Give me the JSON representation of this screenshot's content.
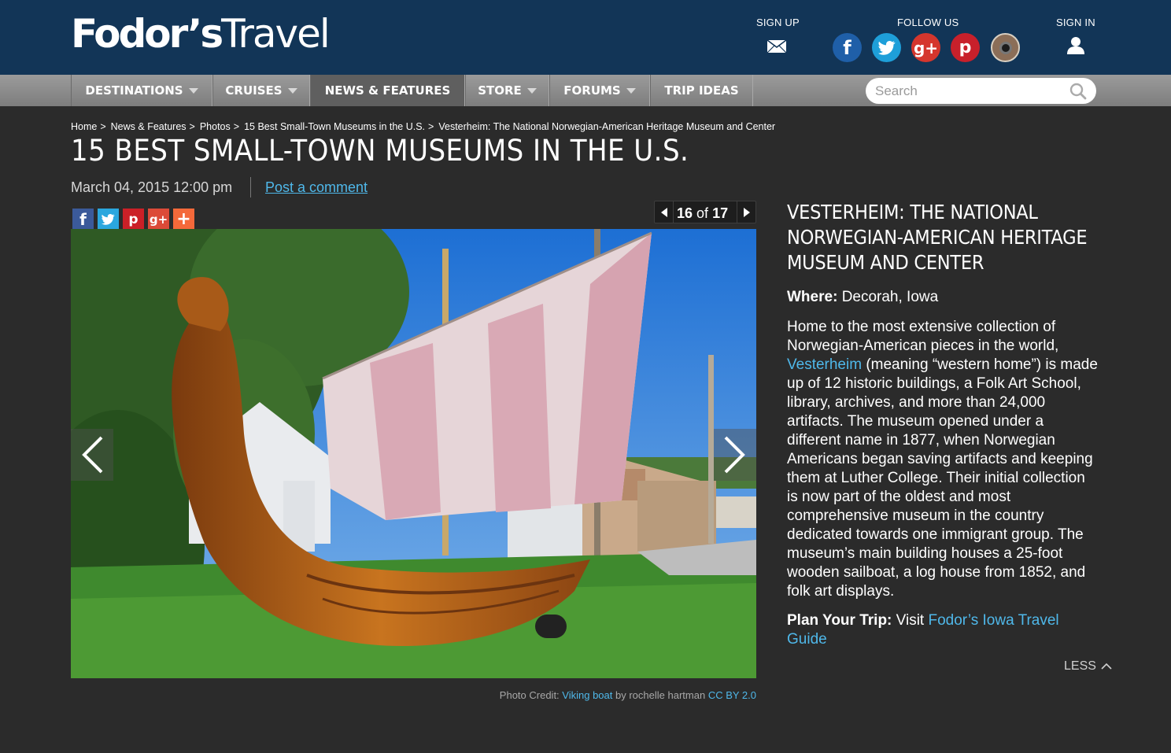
{
  "header": {
    "logo_bold": "Fodor’s",
    "logo_light": "Travel",
    "signup_label": "SIGN UP",
    "follow_label": "FOLLOW US",
    "signin_label": "SIGN IN",
    "icons": [
      "mail-icon",
      "facebook-icon",
      "twitter-icon",
      "google-plus-icon",
      "pinterest-icon",
      "instagram-icon",
      "user-icon"
    ],
    "social": {
      "facebook": "f",
      "twitter": "t",
      "google_plus": "g+",
      "pinterest": "p"
    }
  },
  "nav": {
    "items": [
      {
        "label": "DESTINATIONS",
        "dropdown": true
      },
      {
        "label": "CRUISES",
        "dropdown": true
      },
      {
        "label": "NEWS & FEATURES",
        "dropdown": false,
        "active": true
      },
      {
        "label": "STORE",
        "dropdown": true
      },
      {
        "label": "FORUMS",
        "dropdown": true
      },
      {
        "label": "TRIP IDEAS",
        "dropdown": false
      }
    ],
    "search_placeholder": "Search"
  },
  "breadcrumb": [
    "Home",
    "News & Features",
    "Photos",
    "15 Best Small-Town Museums in the U.S.",
    "Vesterheim: The National Norwegian-American Heritage Museum and Center"
  ],
  "article": {
    "title": "15 Best Small-Town Museums in the U.S.",
    "date": "March 04, 2015 12:00 pm",
    "comment_link": "Post a comment"
  },
  "share": {
    "facebook": "f",
    "twitter": "t",
    "pinterest": "p",
    "google_plus": "g+",
    "more": "+"
  },
  "gallery": {
    "current": "16",
    "of_label": "of",
    "total": "17"
  },
  "photo_credit": {
    "prefix": "Photo Credit:",
    "title": "Viking boat",
    "by": "by rochelle hartman",
    "license": "CC BY 2.0"
  },
  "slide": {
    "title": "Vesterheim: The National Norwegian-American Heritage Museum and Center",
    "where_label": "Where:",
    "where_value": "Decorah, Iowa",
    "desc_1": "Home to the most extensive collection of Norwegian-American pieces in the world,",
    "desc_link": "Vesterheim",
    "desc_2": "(meaning “western home”) is made up of 12 historic buildings, a Folk Art School, library, archives, and more than 24,000 artifacts. The museum opened under a different name in 1877, when Norwegian Americans began saving artifacts and keeping them at Luther College. Their initial collection is now part of the oldest and most comprehensive museum in the country dedicated towards one immigrant group. The museum’s main building houses a 25-foot wooden sailboat, a log house from 1852, and folk art displays.",
    "plan_label": "Plan Your Trip:",
    "plan_visit": "Visit",
    "plan_link": "Fodor’s Iowa Travel Guide",
    "less_label": "LESS"
  },
  "colors": {
    "header_bg": "#123557",
    "page_bg": "#2b2b2b",
    "link": "#4fb8ea"
  }
}
